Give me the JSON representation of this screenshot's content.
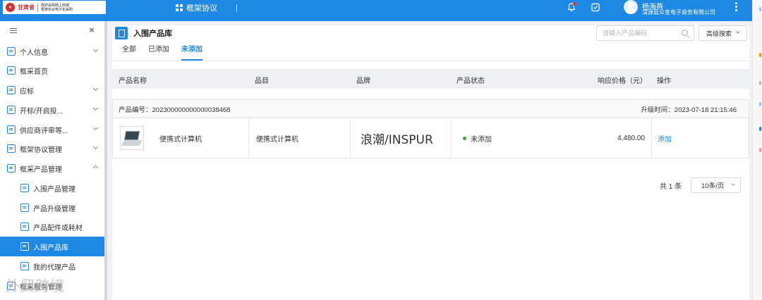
{
  "header": {
    "logo_province": "甘肃省",
    "logo_line1": "政府采购网上商城",
    "logo_line2": "框架协议电子化采购",
    "title": "框架协议",
    "title_separator": "|",
    "user_name": "杨海燕",
    "user_company": "渭源县众金电子商务有限公司"
  },
  "sidebar": {
    "items": [
      {
        "label": "个人信息",
        "expanded": false
      },
      {
        "label": "框采首页"
      },
      {
        "label": "应标",
        "expanded": false
      },
      {
        "label": "开标/开启投...",
        "expanded": false
      },
      {
        "label": "供应商评审等...",
        "expanded": false
      },
      {
        "label": "框架协议管理",
        "expanded": false
      },
      {
        "label": "框采产品管理",
        "expanded": true
      }
    ],
    "sub_items": [
      {
        "label": "入围产品管理"
      },
      {
        "label": "产品升级管理"
      },
      {
        "label": "产品配件或耗材"
      },
      {
        "label": "入围产品库",
        "active": true
      },
      {
        "label": "我的代理产品"
      }
    ],
    "partial_item": "框采服务管理",
    "watermark": "外贸跨境"
  },
  "main": {
    "page_title": "入围产品库",
    "search_placeholder": "请输入产品编码",
    "advanced_search": "高级搜索",
    "tabs": [
      {
        "label": "全部"
      },
      {
        "label": "已添加"
      },
      {
        "label": "未添加",
        "active": true
      }
    ],
    "columns": {
      "name": "产品名称",
      "category": "品目",
      "brand": "品牌",
      "status": "产品状态",
      "price": "响应价格（元）",
      "action": "操作"
    },
    "product": {
      "code_label": "产品编号：",
      "code": "202300000000000038468",
      "upgrade_label": "升级时间：",
      "upgrade_time": "2023-07-18 21:15:46",
      "name": "便携式计算机",
      "category": "便携式计算机",
      "brand": "浪潮/INSPUR",
      "status": "未添加",
      "price": "4,480.00",
      "action": "添加"
    },
    "pager": {
      "total": "共 1 条",
      "page_size": "10条/页"
    }
  },
  "colors": {
    "primary": "#1e88e5",
    "status_green": "#43a047"
  }
}
